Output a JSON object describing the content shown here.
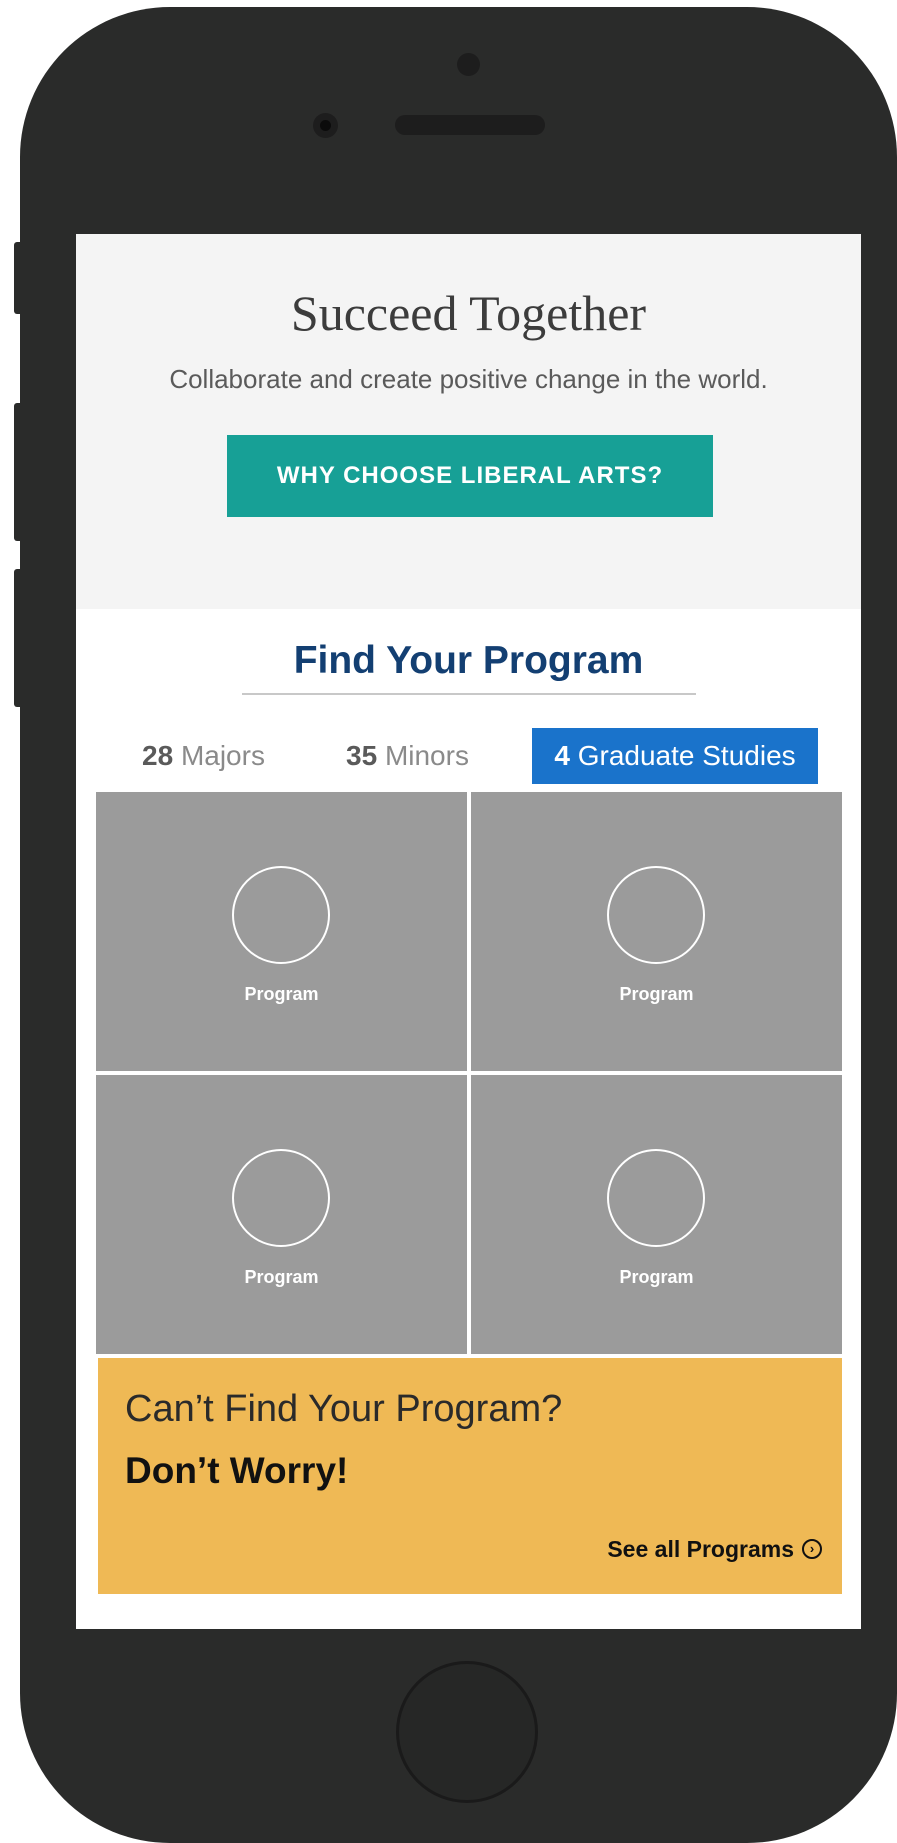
{
  "hero": {
    "title": "Succeed Together",
    "subtitle": "Collaborate and create positive change in the world.",
    "cta_label": "WHY CHOOSE LIBERAL ARTS?"
  },
  "programs": {
    "title": "Find Your Program",
    "tabs": [
      {
        "count": "28",
        "label": "Majors"
      },
      {
        "count": "35",
        "label": "Minors"
      },
      {
        "count": "4",
        "label": "Graduate Studies",
        "active": true
      }
    ],
    "tiles": [
      {
        "label": "Program"
      },
      {
        "label": "Program"
      },
      {
        "label": "Program"
      },
      {
        "label": "Program"
      }
    ]
  },
  "cta": {
    "line1": "Can’t Find Your Program?",
    "line2": "Don’t Worry!",
    "link_label": "See all Programs",
    "link_icon": "chevron-right-circle-icon"
  },
  "colors": {
    "accent_teal": "#17a096",
    "heading_blue": "#133f72",
    "tab_active": "#1a73cb",
    "cta_yellow": "#efb955",
    "tile_gray": "#9b9b9b"
  }
}
